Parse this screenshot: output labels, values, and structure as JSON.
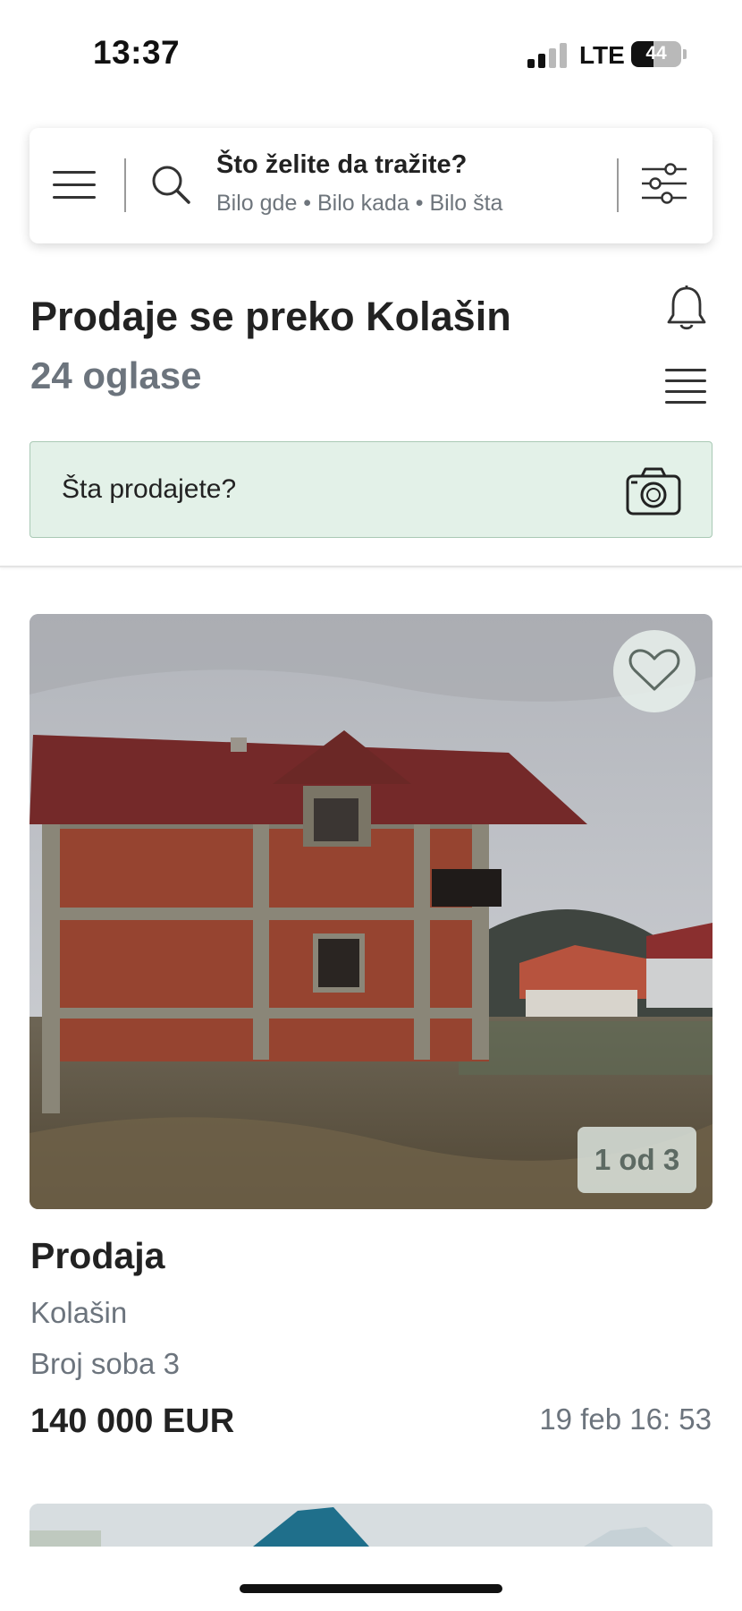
{
  "status_bar": {
    "time": "13:37",
    "network": "LTE",
    "battery": "44",
    "battery_level": 0.44
  },
  "search": {
    "title": "Što želite da tražite?",
    "subtitle": "Bilo gde • Bilo kada • Bilo šta"
  },
  "heading": {
    "title": "Prodaje se preko Kolašin",
    "count": "24 oglase"
  },
  "sell_bar": {
    "placeholder": "Šta prodajete?"
  },
  "listings": [
    {
      "title": "Prodaja",
      "location": "Kolašin",
      "rooms": "Broj soba 3",
      "price": "140 000 EUR",
      "date": "19 feb 16: 53",
      "photo_counter": "1 od 3"
    }
  ],
  "colors": {
    "accent_bg": "#e3f1e8",
    "accent_border": "#a9c9b5",
    "muted_text": "#6c747d",
    "primary_text": "#222222"
  },
  "icons": [
    "menu-icon",
    "search-icon",
    "filter-icon",
    "bell-icon",
    "list-icon",
    "camera-icon",
    "heart-icon"
  ]
}
